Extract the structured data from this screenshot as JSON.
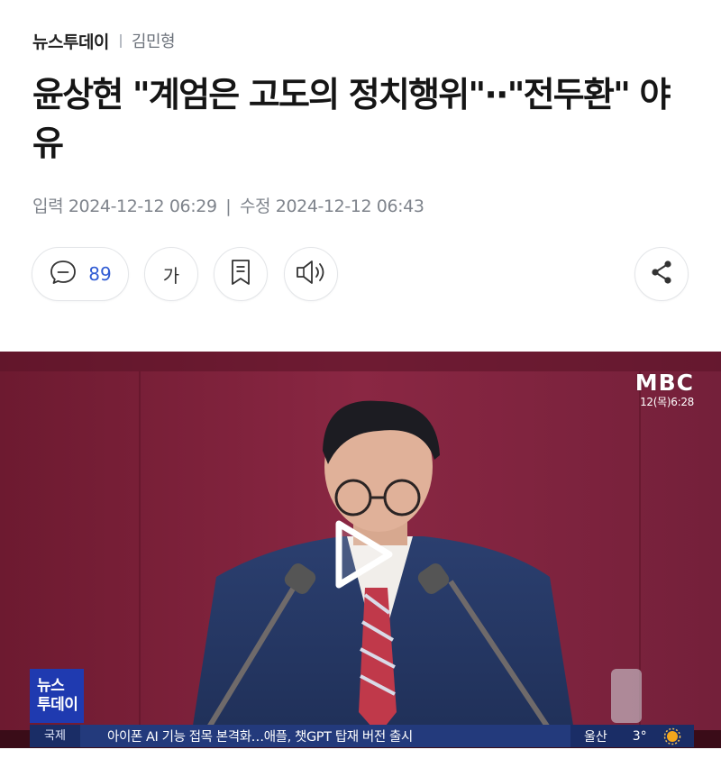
{
  "header": {
    "brand": "뉴스투데이",
    "author": "김민형"
  },
  "article": {
    "title": "윤상현 \"계엄은 고도의 정치행위\"··\"전두환\" 야유",
    "input_label": "입력",
    "input_time": "2024-12-12 06:29",
    "edit_label": "수정",
    "edit_time": "2024-12-12 06:43"
  },
  "actions": {
    "comment_count": "89",
    "font_size_label": "가"
  },
  "video": {
    "channel": "MBC",
    "timestamp": "12(목)6:28",
    "logo_line1": "뉴스",
    "logo_line2": "투데이",
    "ticker_category": "국제",
    "ticker_text": "아이폰 AI 기능 접목 본격화…애플, 챗GPT 탑재 버전 출시",
    "weather_city": "울산",
    "weather_temp": "3°"
  },
  "icons": [
    "comment-icon",
    "font-size-icon",
    "bookmark-icon",
    "audio-icon",
    "share-icon",
    "play-icon",
    "sun-icon"
  ],
  "colors": {
    "accent": "#2f5bd3",
    "curtain": "#7a1f37",
    "ticker": "#233a7c"
  }
}
